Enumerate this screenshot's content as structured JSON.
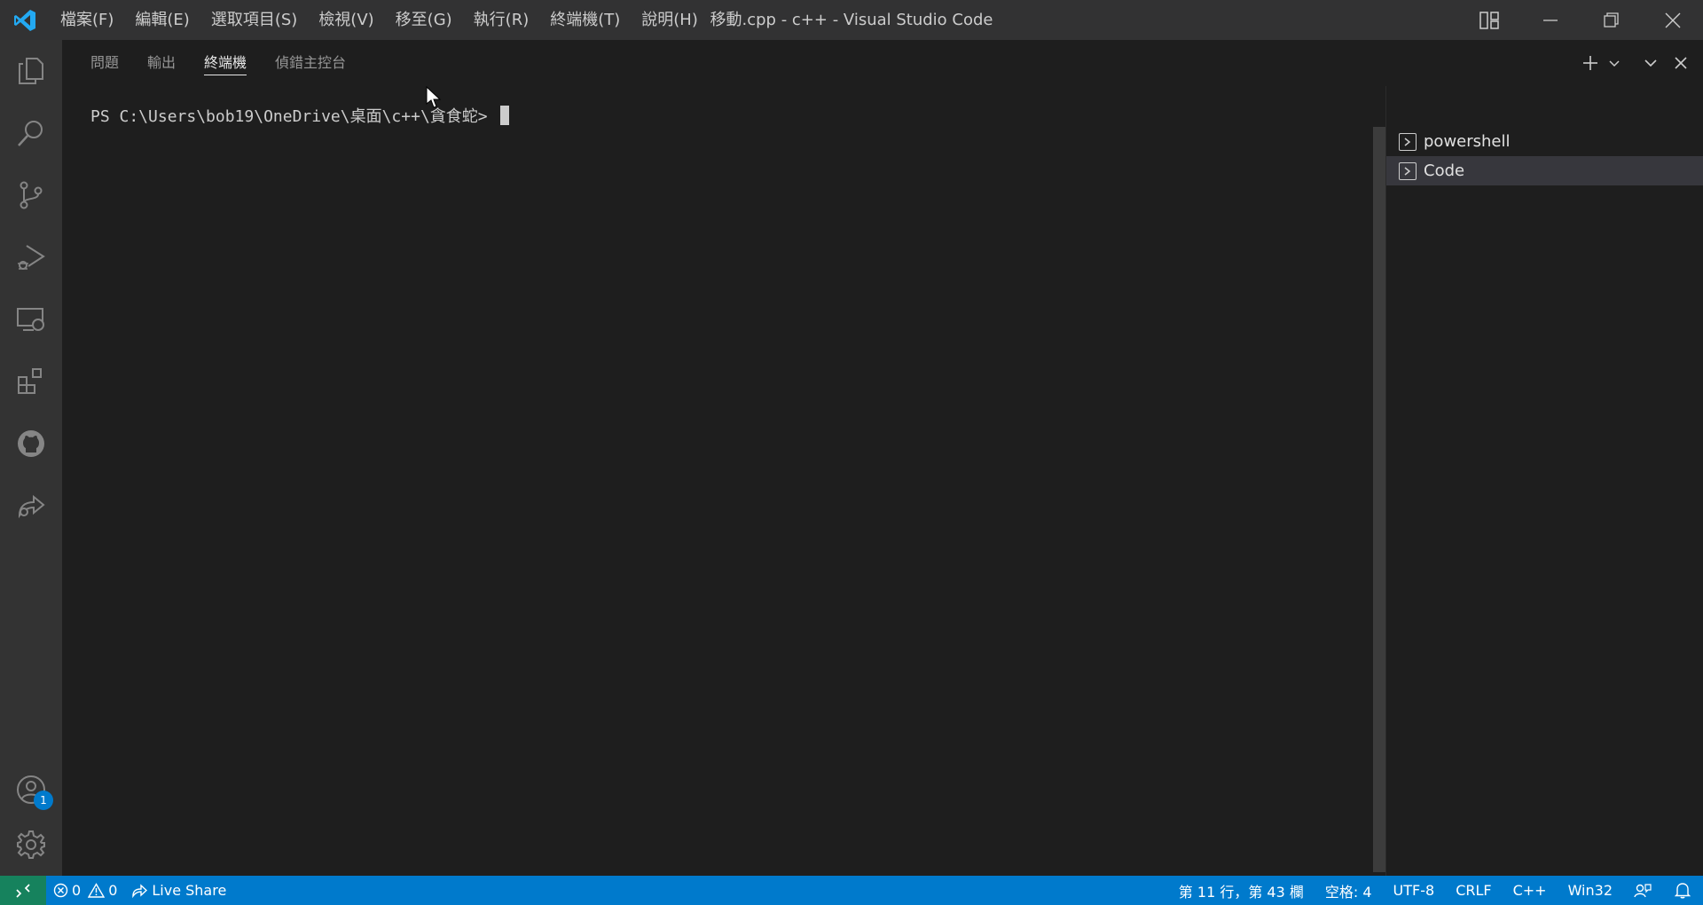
{
  "titlebar": {
    "title": "移動.cpp - c++ - Visual Studio Code",
    "menu": [
      "檔案(F)",
      "編輯(E)",
      "選取項目(S)",
      "檢視(V)",
      "移至(G)",
      "執行(R)",
      "終端機(T)",
      "說明(H)"
    ]
  },
  "activitybar": {
    "items": [
      "files-icon",
      "search-icon",
      "source-control-icon",
      "run-debug-icon",
      "remote-explorer-icon",
      "extensions-icon",
      "github-icon",
      "live-share-icon"
    ],
    "accounts_badge": "1"
  },
  "panel": {
    "tabs": [
      "問題",
      "輸出",
      "終端機",
      "偵錯主控台"
    ],
    "active_tab": "終端機",
    "terminal_prompt": "PS C:\\Users\\bob19\\OneDrive\\桌面\\c++\\貪食蛇> ",
    "terminals": [
      {
        "label": "powershell",
        "selected": false
      },
      {
        "label": "Code",
        "selected": true
      }
    ]
  },
  "statusbar": {
    "errors": "0",
    "warnings": "0",
    "live_share": "Live Share",
    "position": "第 11 行，第 43 欄",
    "spaces": "空格: 4",
    "encoding": "UTF-8",
    "eol": "CRLF",
    "language": "C++",
    "platform": "Win32"
  },
  "colors": {
    "accent": "#007acc",
    "remote": "#16825d",
    "logo": "#23a9f2"
  }
}
